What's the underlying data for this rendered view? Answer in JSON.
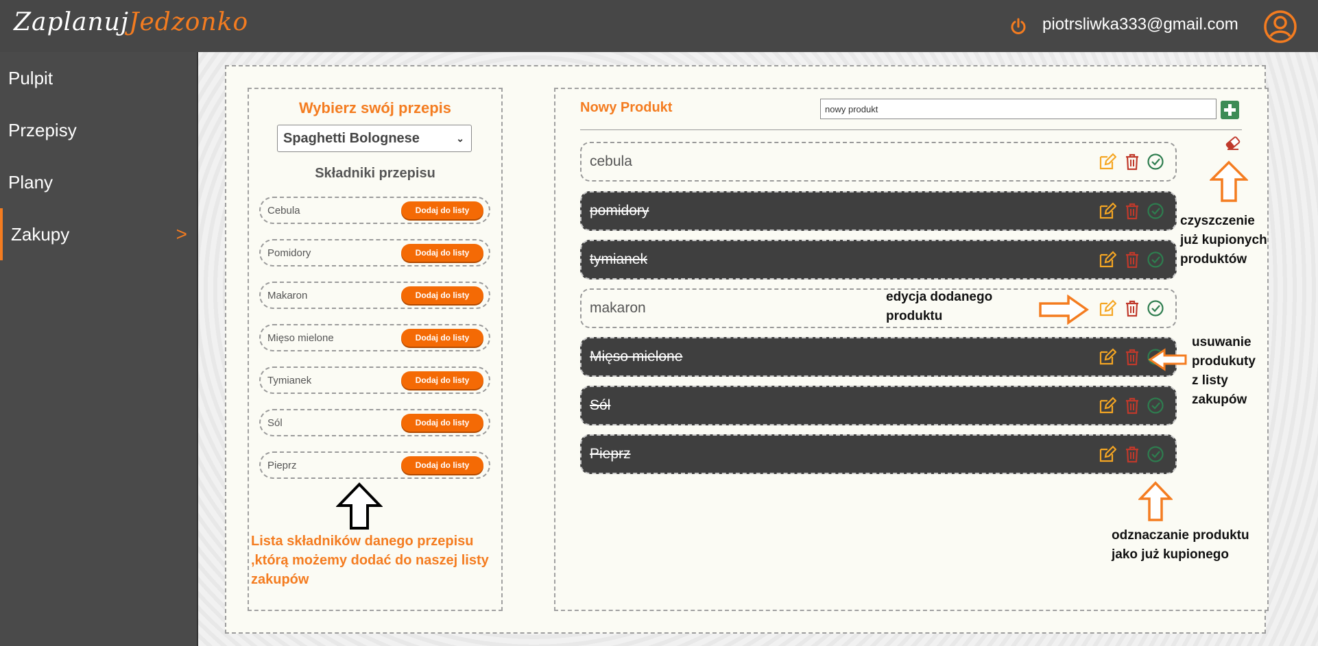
{
  "header": {
    "logo_part1": "Zaplanuj",
    "logo_part2": "Jedzonko",
    "user_email": "piotrsliwka333@gmail.com"
  },
  "sidebar": {
    "items": [
      {
        "label": "Pulpit"
      },
      {
        "label": "Przepisy"
      },
      {
        "label": "Plany"
      },
      {
        "label": "Zakupy",
        "chevron": ">"
      }
    ]
  },
  "recipe": {
    "title": "Wybierz swój przepis",
    "selected": "Spaghetti Bolognese",
    "ingredients_title": "Składniki przepisu",
    "add_label": "Dodaj do listy",
    "ingredients": [
      "Cebula",
      "Pomidory",
      "Makaron",
      "Mięso mielone",
      "Tymianek",
      "Sól",
      "Pieprz"
    ]
  },
  "shopping": {
    "new_label": "Nowy Produkt",
    "input_value": "nowy produkt",
    "products": [
      {
        "name": "cebula",
        "bought": false
      },
      {
        "name": "pomidory",
        "bought": true
      },
      {
        "name": "tymianek",
        "bought": true
      },
      {
        "name": "makaron",
        "bought": false
      },
      {
        "name": "Mięso mielone",
        "bought": true
      },
      {
        "name": "Sól",
        "bought": true
      },
      {
        "name": "Pieprz",
        "bought": true
      }
    ]
  },
  "annotations": {
    "clear": [
      "czyszczenie",
      "już kupionych",
      "produktów"
    ],
    "edit": [
      "edycja dodanego",
      "produktu"
    ],
    "remove": [
      "usuwanie",
      "produkuty",
      "z listy",
      "zakupów"
    ],
    "mark": [
      "odznaczanie produktu",
      "jako już kupionego"
    ],
    "ingredients": [
      "Lista składników danego przepisu",
      ",którą możemy dodać do naszej listy",
      "zakupów"
    ]
  },
  "colors": {
    "accent": "#f47c20",
    "header": "#474747",
    "sidebar": "#4a4a4a",
    "bought_row": "#3f3f3f",
    "edit_icon": "#f5a623",
    "trash_icon": "#c0392b",
    "check_icon": "#2e7d4f"
  },
  "icons": [
    "power-icon",
    "user-icon",
    "chevron-down-icon",
    "plus-icon",
    "eraser-icon",
    "edit-icon",
    "trash-icon",
    "check-circle-icon"
  ]
}
